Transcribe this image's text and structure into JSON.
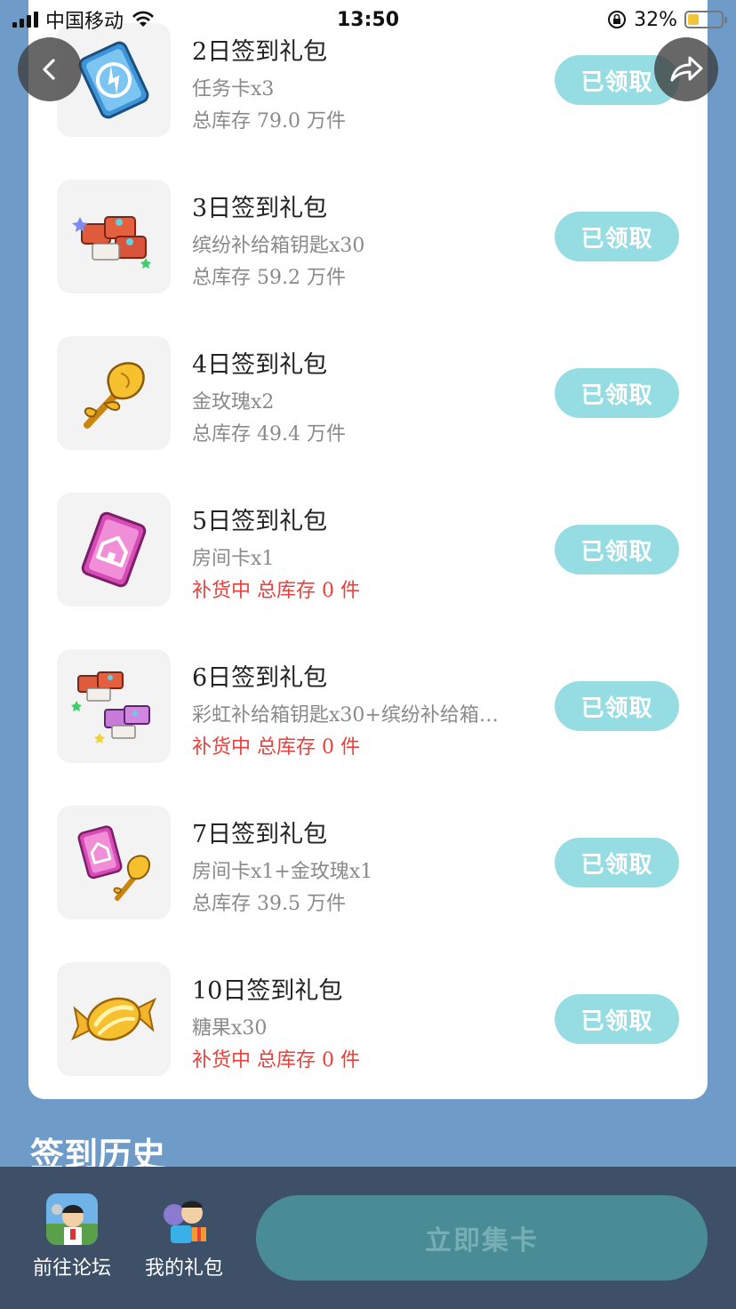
{
  "status_bar": {
    "carrier": "中国移动",
    "time": "13:50",
    "battery": "32%",
    "battery_level": 0.32
  },
  "gifts": [
    {
      "title": "2日签到礼包",
      "desc": "任务卡x3",
      "stock": "总库存 79.0 万件",
      "restocking": false,
      "button": "已领取",
      "icon": "task-card-icon"
    },
    {
      "title": "3日签到礼包",
      "desc": "缤纷补给箱钥匙x30",
      "stock": "总库存 59.2 万件",
      "restocking": false,
      "button": "已领取",
      "icon": "supply-key-icon"
    },
    {
      "title": "4日签到礼包",
      "desc": "金玫瑰x2",
      "stock": "总库存 49.4 万件",
      "restocking": false,
      "button": "已领取",
      "icon": "gold-rose-icon"
    },
    {
      "title": "5日签到礼包",
      "desc": "房间卡x1",
      "stock": "补货中 总库存 0 件",
      "restocking": true,
      "button": "已领取",
      "icon": "room-card-icon"
    },
    {
      "title": "6日签到礼包",
      "desc": "彩虹补给箱钥匙x30+缤纷补给箱…",
      "stock": "补货中 总库存 0 件",
      "restocking": true,
      "button": "已领取",
      "icon": "rainbow-key-icon"
    },
    {
      "title": "7日签到礼包",
      "desc": "房间卡x1+金玫瑰x1",
      "stock": "总库存 39.5 万件",
      "restocking": false,
      "button": "已领取",
      "icon": "room-card-rose-icon"
    },
    {
      "title": "10日签到礼包",
      "desc": "糖果x30",
      "stock": "补货中 总库存 0 件",
      "restocking": true,
      "button": "已领取",
      "icon": "candy-icon"
    }
  ],
  "history": {
    "title": "签到历史"
  },
  "bottom_nav": {
    "forum_label": "前往论坛",
    "gifts_label": "我的礼包",
    "collect_label": "立即集卡"
  },
  "colors": {
    "page_bg": "#6f9bc8",
    "claimed_button": "#96dde3",
    "restock_text": "#e8413c",
    "bottom_bar": "#3d5068",
    "collect_button": "#4a8c95"
  }
}
